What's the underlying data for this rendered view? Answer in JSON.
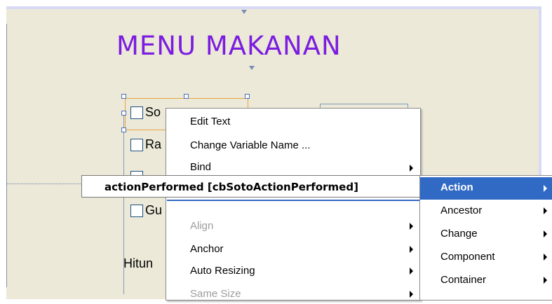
{
  "form": {
    "title": "MENU MAKANAN",
    "checkboxes": [
      {
        "label": "So"
      },
      {
        "label": "Ra"
      },
      {
        "label": ""
      },
      {
        "label": "Gu"
      }
    ],
    "hitung_label": "Hitun"
  },
  "context_menu": {
    "items": [
      {
        "label": "Edit Text",
        "enabled": true,
        "submenu": false
      },
      {
        "label": "Change Variable Name ...",
        "enabled": true,
        "submenu": false
      },
      {
        "label": "Bind",
        "enabled": true,
        "submenu": true
      },
      {
        "label": "Align",
        "enabled": false,
        "submenu": true
      },
      {
        "label": "Anchor",
        "enabled": true,
        "submenu": true
      },
      {
        "label": "Auto Resizing",
        "enabled": true,
        "submenu": true
      },
      {
        "label": "Same Size",
        "enabled": false,
        "submenu": true
      }
    ]
  },
  "events_item": {
    "label": "actionPerformed [cbSotoActionPerformed]"
  },
  "events_submenu": {
    "items": [
      {
        "label": "Action",
        "active": true
      },
      {
        "label": "Ancestor",
        "active": false
      },
      {
        "label": "Change",
        "active": false
      },
      {
        "label": "Component",
        "active": false
      },
      {
        "label": "Container",
        "active": false
      }
    ]
  },
  "colors": {
    "title": "#7b1ce0",
    "selection_highlight": "#316ac5",
    "form_background": "#ece9d8",
    "selection_border": "#e8a33e"
  }
}
